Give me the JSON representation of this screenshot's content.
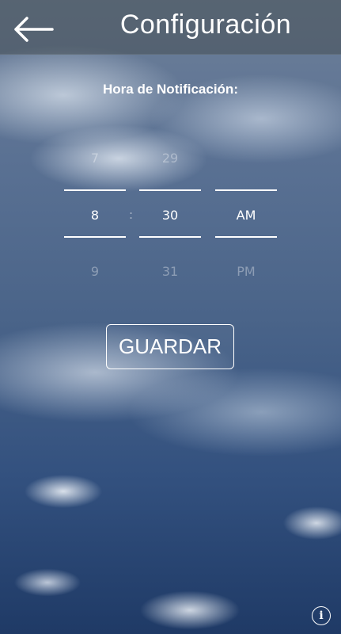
{
  "header": {
    "title": "Configuración",
    "back_icon": "arrow-left-icon"
  },
  "notification": {
    "label": "Hora de Notificación:"
  },
  "time_picker": {
    "separator": ":",
    "hour": {
      "previous": "7",
      "selected": "8",
      "next": "9"
    },
    "minute": {
      "previous": "29",
      "selected": "30",
      "next": "31"
    },
    "period": {
      "previous": "",
      "selected": "AM",
      "next": "PM"
    }
  },
  "save_button": {
    "label": "GUARDAR"
  },
  "info_button": {
    "icon": "info-icon",
    "glyph": "i"
  }
}
